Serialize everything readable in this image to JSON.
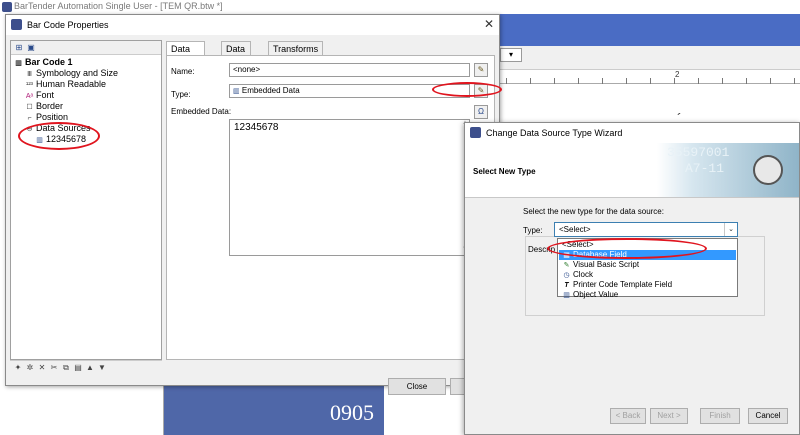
{
  "app": {
    "window_title": "BarTender Automation Single User - [TEM QR.btw *]",
    "ruler_number": "2",
    "label_number": "0905",
    "label_number_partial": "8",
    "accent_glyph": "´"
  },
  "barcode_dialog": {
    "title": "Bar Code Properties",
    "close_glyph": "✕",
    "tree": {
      "root": "Bar Code 1",
      "items": [
        {
          "label": "Symbology and Size",
          "icon": "barcode-icon"
        },
        {
          "label": "Human Readable",
          "icon": "hr-icon"
        },
        {
          "label": "Font",
          "icon": "font-icon"
        },
        {
          "label": "Border",
          "icon": "border-icon"
        },
        {
          "label": "Position",
          "icon": "position-icon"
        },
        {
          "label": "Data Sources",
          "icon": "datasource-icon"
        },
        {
          "label": "12345678",
          "icon": "embedded-data-icon"
        }
      ]
    },
    "tabs": [
      "Data Source",
      "Data Type",
      "Transforms"
    ],
    "active_tab": "Data Source",
    "name_label": "Name:",
    "name_value": "<none>",
    "type_label": "Type:",
    "type_value": "Embedded Data",
    "embedded_label": "Embedded Data:",
    "embedded_value": "12345678",
    "omega_glyph": "Ω",
    "close_button": "Close",
    "help_button": "H"
  },
  "wizard_dialog": {
    "title": "Change Data Source Type Wizard",
    "header": "Select New Type",
    "banner_text_1": "35597001",
    "banner_text_2": "A7-11",
    "prompt": "Select the new type for the data source:",
    "type_label": "Type:",
    "selected_value": "<Select>",
    "description_label": "Descrip",
    "options": [
      {
        "label": "<Select>",
        "icon": "",
        "selected": false
      },
      {
        "label": "Database Field",
        "icon": "database-icon",
        "selected": true
      },
      {
        "label": "Visual Basic Script",
        "icon": "vb-script-icon",
        "selected": false
      },
      {
        "label": "Clock",
        "icon": "clock-icon",
        "selected": false
      },
      {
        "label": "Printer Code Template Field",
        "icon": "printer-code-icon",
        "selected": false
      },
      {
        "label": "Object Value",
        "icon": "object-value-icon",
        "selected": false
      }
    ],
    "buttons": {
      "back": "< Back",
      "next": "Next >",
      "finish": "Finish",
      "cancel": "Cancel"
    }
  },
  "colors": {
    "annotation_red": "#e0141e",
    "selection_blue": "#3399ff",
    "label_art_blue": "#4f67a8"
  }
}
